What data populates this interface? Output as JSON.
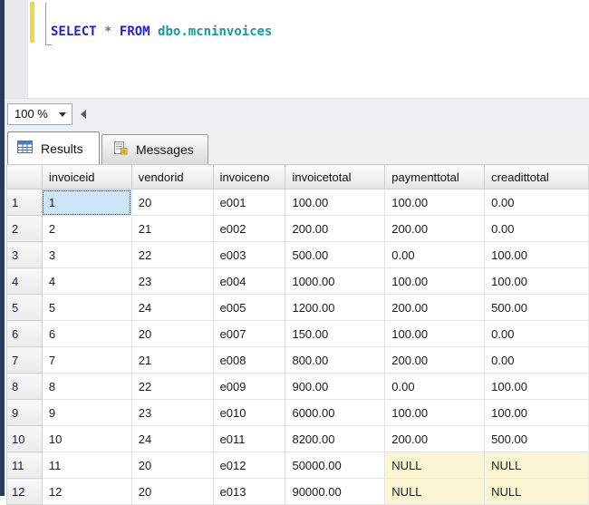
{
  "editor": {
    "sql_tokens": [
      {
        "text": "SELECT",
        "type": "keyword"
      },
      {
        "text": " ",
        "type": "plain"
      },
      {
        "text": "*",
        "type": "operator"
      },
      {
        "text": " ",
        "type": "plain"
      },
      {
        "text": "FROM",
        "type": "keyword"
      },
      {
        "text": " ",
        "type": "plain"
      },
      {
        "text": "dbo.mcninvoices",
        "type": "object"
      }
    ],
    "token_colors": {
      "keyword": "#2020d6",
      "operator": "#7a7a7a",
      "object": "#1a9a9a",
      "plain": "#000000"
    },
    "change_bar_color": "#f2d64b"
  },
  "zoombar": {
    "zoom_value": "100 %"
  },
  "tabs": {
    "results_label": "Results",
    "messages_label": "Messages"
  },
  "grid": {
    "columns": [
      "invoiceid",
      "vendorid",
      "invoiceno",
      "invoicetotal",
      "paymenttotal",
      "creadittotal"
    ],
    "rows": [
      {
        "n": "1",
        "cells": [
          "1",
          "20",
          "e001",
          "100.00",
          "100.00",
          "0.00"
        ]
      },
      {
        "n": "2",
        "cells": [
          "2",
          "21",
          "e002",
          "200.00",
          "200.00",
          "0.00"
        ]
      },
      {
        "n": "3",
        "cells": [
          "3",
          "22",
          "e003",
          "500.00",
          "0.00",
          "100.00"
        ]
      },
      {
        "n": "4",
        "cells": [
          "4",
          "23",
          "e004",
          "1000.00",
          "100.00",
          "100.00"
        ]
      },
      {
        "n": "5",
        "cells": [
          "5",
          "24",
          "e005",
          "1200.00",
          "200.00",
          "500.00"
        ]
      },
      {
        "n": "6",
        "cells": [
          "6",
          "20",
          "e007",
          "150.00",
          "100.00",
          "0.00"
        ]
      },
      {
        "n": "7",
        "cells": [
          "7",
          "21",
          "e008",
          "800.00",
          "200.00",
          "0.00"
        ]
      },
      {
        "n": "8",
        "cells": [
          "8",
          "22",
          "e009",
          "900.00",
          "0.00",
          "100.00"
        ]
      },
      {
        "n": "9",
        "cells": [
          "9",
          "23",
          "e010",
          "6000.00",
          "100.00",
          "100.00"
        ]
      },
      {
        "n": "10",
        "cells": [
          "10",
          "24",
          "e011",
          "8200.00",
          "200.00",
          "500.00"
        ]
      },
      {
        "n": "11",
        "cells": [
          "11",
          "20",
          "e012",
          "50000.00",
          "NULL",
          "NULL"
        ]
      },
      {
        "n": "12",
        "cells": [
          "12",
          "20",
          "e013",
          "90000.00",
          "NULL",
          "NULL"
        ]
      }
    ],
    "null_text": "NULL",
    "selected": {
      "row_index": 0,
      "col_index": 0
    },
    "colors": {
      "null_bg": "#faf5d2",
      "selected_bg": "#cde6f7",
      "left_strip": "#2b3a5c"
    }
  }
}
